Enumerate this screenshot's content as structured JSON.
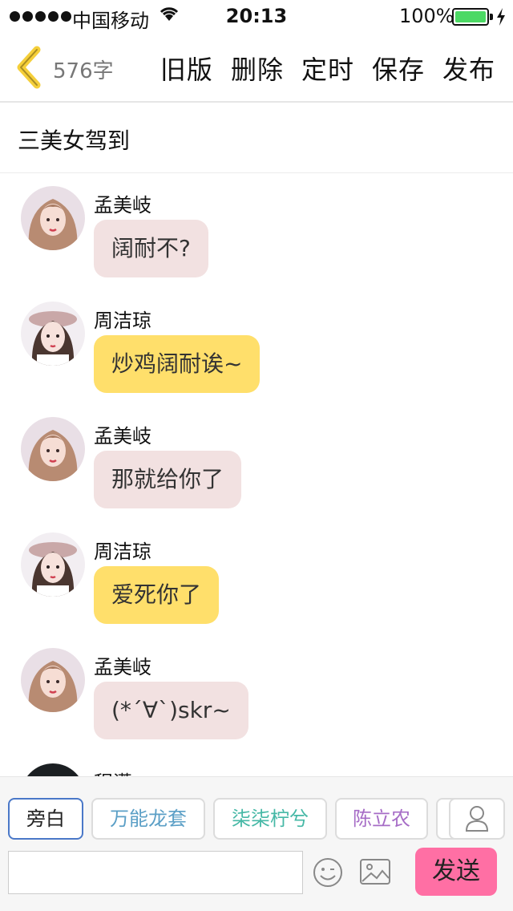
{
  "status_bar": {
    "carrier": "中国移动",
    "time": "20:13",
    "battery_percent": "100%",
    "battery_level": 1.0,
    "battery_color": "#4cd964"
  },
  "navbar": {
    "back_icon": "chevron-left-icon",
    "back_icon_color": "#f5cf3a",
    "word_count": "576字",
    "actions": [
      "旧版",
      "删除",
      "定时",
      "保存",
      "发布"
    ]
  },
  "story": {
    "title": "三美女驾到"
  },
  "messages": [
    {
      "sender": "孟美岐",
      "text": "阔耐不?",
      "style": "pink",
      "avatar": "avatar-meng"
    },
    {
      "sender": "周洁琼",
      "text": "炒鸡阔耐诶~",
      "style": "yellow",
      "avatar": "avatar-zhou"
    },
    {
      "sender": "孟美岐",
      "text": "那就给你了",
      "style": "pink",
      "avatar": "avatar-meng"
    },
    {
      "sender": "周洁琼",
      "text": "爱死你了",
      "style": "yellow",
      "avatar": "avatar-zhou"
    },
    {
      "sender": "孟美岐",
      "text": "(*´∀`)skr~",
      "style": "pink",
      "avatar": "avatar-meng"
    },
    {
      "sender": "程潇",
      "text": "",
      "style": "pink",
      "avatar": "avatar-cheng"
    }
  ],
  "character_chips": [
    {
      "label": "旁白",
      "color": "#222222",
      "active": true
    },
    {
      "label": "万能龙套",
      "color": "#5b9fc6",
      "active": false
    },
    {
      "label": "柒柒柠兮",
      "color": "#46b8a6",
      "active": false
    },
    {
      "label": "陈立农",
      "color": "#a66cc6",
      "active": false
    },
    {
      "label": "",
      "color": "#999999",
      "active": false
    }
  ],
  "composer": {
    "input_value": "",
    "input_placeholder": "",
    "emoji_icon": "smiley-icon",
    "image_icon": "image-icon",
    "user_icon": "user-icon",
    "send_label": "发送",
    "send_color": "#ff6fa4"
  }
}
